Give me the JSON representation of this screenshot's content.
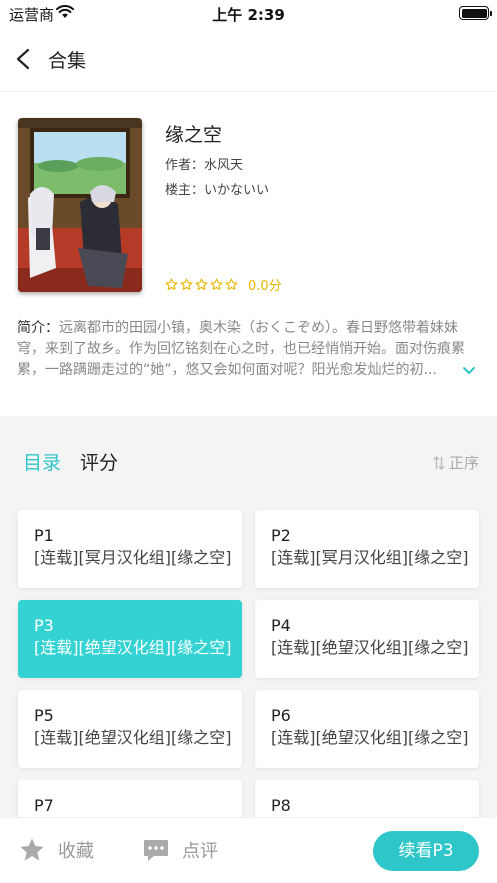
{
  "status_bar": {
    "carrier": "运营商",
    "time": "上午 2:39"
  },
  "nav": {
    "title": "合集"
  },
  "book": {
    "title": "缘之空",
    "author": "作者：水风天",
    "poster": "楼主：いかないい",
    "score": "0.0分",
    "rating_stars": 0,
    "intro_label": "简介：",
    "intro_text": "远离都市的田园小镇，奥木染（おくこぞめ）。春日野悠带着妹妹穹，来到了故乡。作为回忆铭刻在心之时，也已经悄悄开始。面对伤痕累累，一路蹒跚走过的“她”，悠又会如何面对呢？阳光愈发灿烂的初..."
  },
  "tabs": {
    "catalog": "目录",
    "rating": "评分",
    "sort": "正序"
  },
  "episodes": [
    {
      "num": "P1",
      "name": "[连载][冥月汉化组][缘之空]"
    },
    {
      "num": "P2",
      "name": "[连载][冥月汉化组][缘之空]"
    },
    {
      "num": "P3",
      "name": "[连载][绝望汉化组][缘之空]"
    },
    {
      "num": "P4",
      "name": "[连载][绝望汉化组][缘之空]"
    },
    {
      "num": "P5",
      "name": "[连载][绝望汉化组][缘之空]"
    },
    {
      "num": "P6",
      "name": "[连载][绝望汉化组][缘之空]"
    },
    {
      "num": "P7",
      "name": ""
    },
    {
      "num": "P8",
      "name": ""
    }
  ],
  "bottom": {
    "favorite": "收藏",
    "review": "点评",
    "continue": "续看P3"
  },
  "colors": {
    "accent": "#2fc6c9",
    "selected_card": "#35d2d3",
    "star": "#e8b500"
  }
}
